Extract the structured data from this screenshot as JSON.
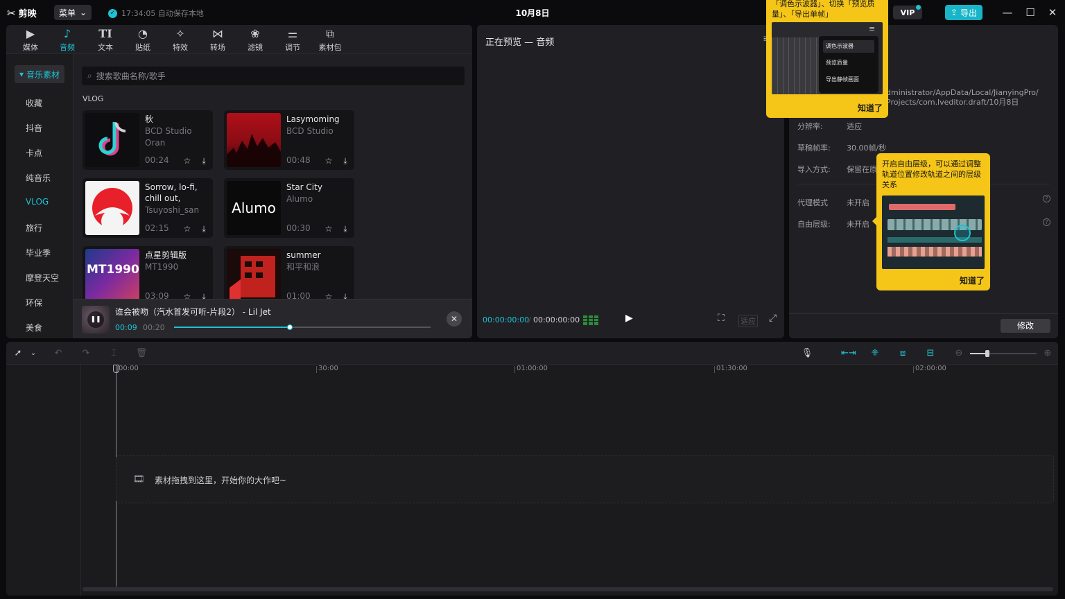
{
  "app": {
    "name": "剪映",
    "menu_label": "菜单",
    "autosave_text": "17:34:05 自动保存本地",
    "project_title": "10月8日",
    "vip_label": "VIP",
    "export_label": "导出"
  },
  "tool_tabs": [
    {
      "label": "媒体",
      "icon": "media-icon"
    },
    {
      "label": "音频",
      "icon": "audio-icon",
      "active": true
    },
    {
      "label": "文本",
      "icon": "text-icon"
    },
    {
      "label": "贴纸",
      "icon": "sticker-icon"
    },
    {
      "label": "特效",
      "icon": "effects-icon"
    },
    {
      "label": "转场",
      "icon": "transition-icon"
    },
    {
      "label": "滤镜",
      "icon": "filter-icon"
    },
    {
      "label": "调节",
      "icon": "adjust-icon"
    },
    {
      "label": "素材包",
      "icon": "package-icon"
    }
  ],
  "categories": {
    "header": "音乐素材",
    "items": [
      "收藏",
      "抖音",
      "卡点",
      "纯音乐",
      "VLOG",
      "旅行",
      "毕业季",
      "摩登天空",
      "环保",
      "美食"
    ],
    "active": "VLOG"
  },
  "search": {
    "placeholder": "搜索歌曲名称/歌手"
  },
  "section_title": "VLOG",
  "tracks": [
    {
      "title": "秋",
      "artist_line1": "BCD Studio",
      "artist_line2": "Oran",
      "duration": "00:24",
      "thumb_text": ""
    },
    {
      "title": "Lasymoming",
      "artist_line1": "BCD Studio",
      "artist_line2": "",
      "duration": "00:48",
      "thumb_text": ""
    },
    {
      "title": "Sorrow, lo-fi, chill out, loop(...",
      "artist_line1": "Tsuyoshi_san",
      "artist_line2": "",
      "duration": "02:15",
      "thumb_text": ""
    },
    {
      "title": "Star City",
      "artist_line1": "Alumo",
      "artist_line2": "",
      "duration": "00:30",
      "thumb_text": "Alumo"
    },
    {
      "title": "点星剪辑版",
      "artist_line1": "MT1990",
      "artist_line2": "",
      "duration": "03:09",
      "thumb_text": "MT1990"
    },
    {
      "title": "summer",
      "artist_line1": "和平和浪",
      "artist_line2": "",
      "duration": "01:00",
      "thumb_text": ""
    }
  ],
  "player": {
    "title": "谁会被吻（汽水首发可听-片段2） - Lil Jet",
    "current": "00:09",
    "total": "00:20",
    "progress": 0.45
  },
  "preview": {
    "title": "正在预览 — 音频",
    "timecode_current": "00:00:00:00",
    "timecode_total": "00:00:00:00",
    "fit_label": "适应"
  },
  "properties": {
    "path_text": "dministrator/AppData/Local/JianyingPro/ Projects/com.lveditor.draft/10月8日",
    "rows": [
      {
        "label": "分辨率:",
        "value": "适应"
      },
      {
        "label": "草稿帧率:",
        "value": "30.00帧/秒"
      },
      {
        "label": "导入方式:",
        "value": "保留在原"
      },
      {
        "label": "代理模式",
        "value": "未开启"
      },
      {
        "label": "自由层级:",
        "value": "未开启"
      }
    ],
    "edit_label": "修改"
  },
  "tooltip_preview": {
    "text": "「调色示波器」、切换「预览质量」、「导出单帧」",
    "menu_items": [
      "调色示波器",
      "预览质量",
      "导出静帧画面"
    ],
    "ok_label": "知道了"
  },
  "tooltip_layer": {
    "text": "开启自由层级，可以通过调整轨道位置修改轨道之间的层级关系",
    "ok_label": "知道了"
  },
  "timeline": {
    "ruler_labels": [
      "00:00",
      "30:00",
      "01:00:00",
      "01:30:00",
      "02:00:00"
    ],
    "drop_hint": "素材拖拽到这里，开始你的大作吧~"
  },
  "colors": {
    "accent": "#1fc2d4",
    "tooltip": "#f5c518",
    "panel": "#202024",
    "background": "#0b0b0d"
  }
}
